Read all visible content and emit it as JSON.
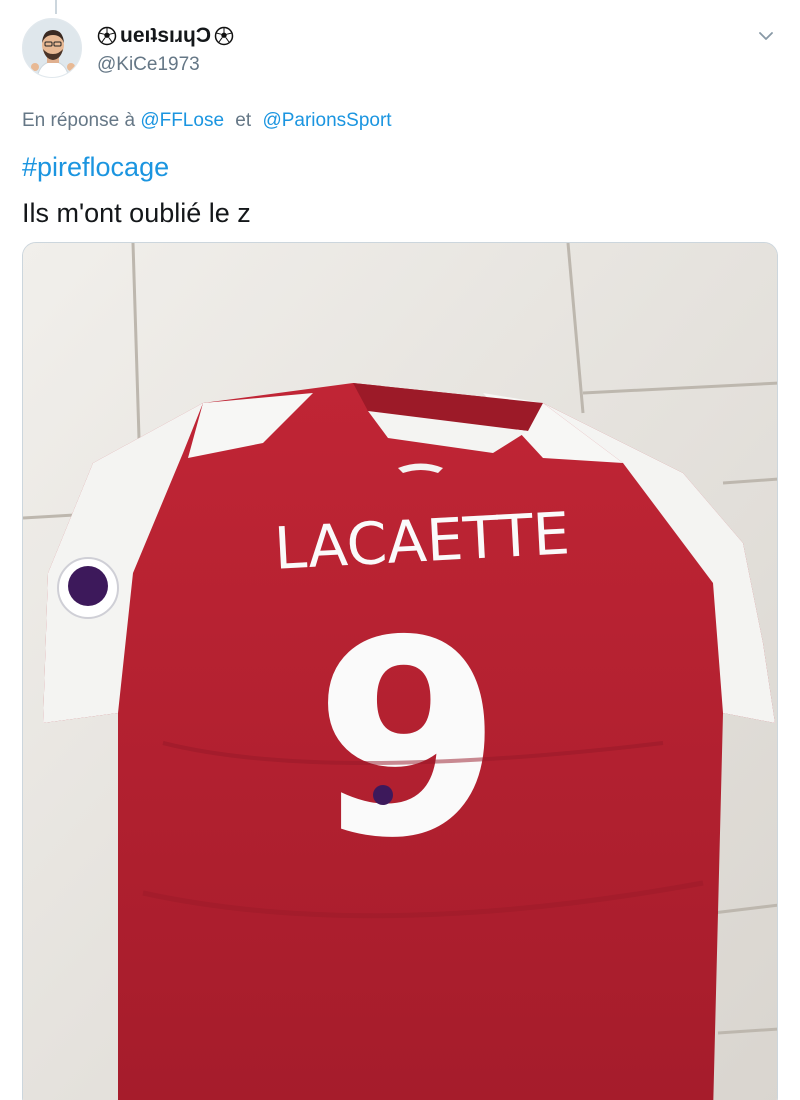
{
  "tweet": {
    "display_name": "ueıʇsıɹɥƆ",
    "username": "@KiCe1973",
    "reply_prefix": "En réponse à",
    "reply_to": [
      "@FFLose",
      "@ParionsSport"
    ],
    "reply_joiner": "et",
    "hashtag": "#pireflocage",
    "text": "Ils m'ont oublié le z"
  },
  "media": {
    "jersey_name": "LACAETTE",
    "jersey_number": "9",
    "colors": {
      "red": "#b3202f",
      "white": "#f4f4f2",
      "floor": "#e9e6e1"
    }
  },
  "icons": {
    "ball": "soccer-ball-icon",
    "chevron": "chevron-down-icon"
  },
  "colors": {
    "link": "#1b95e0",
    "secondary": "#657786",
    "text": "#14171a"
  }
}
